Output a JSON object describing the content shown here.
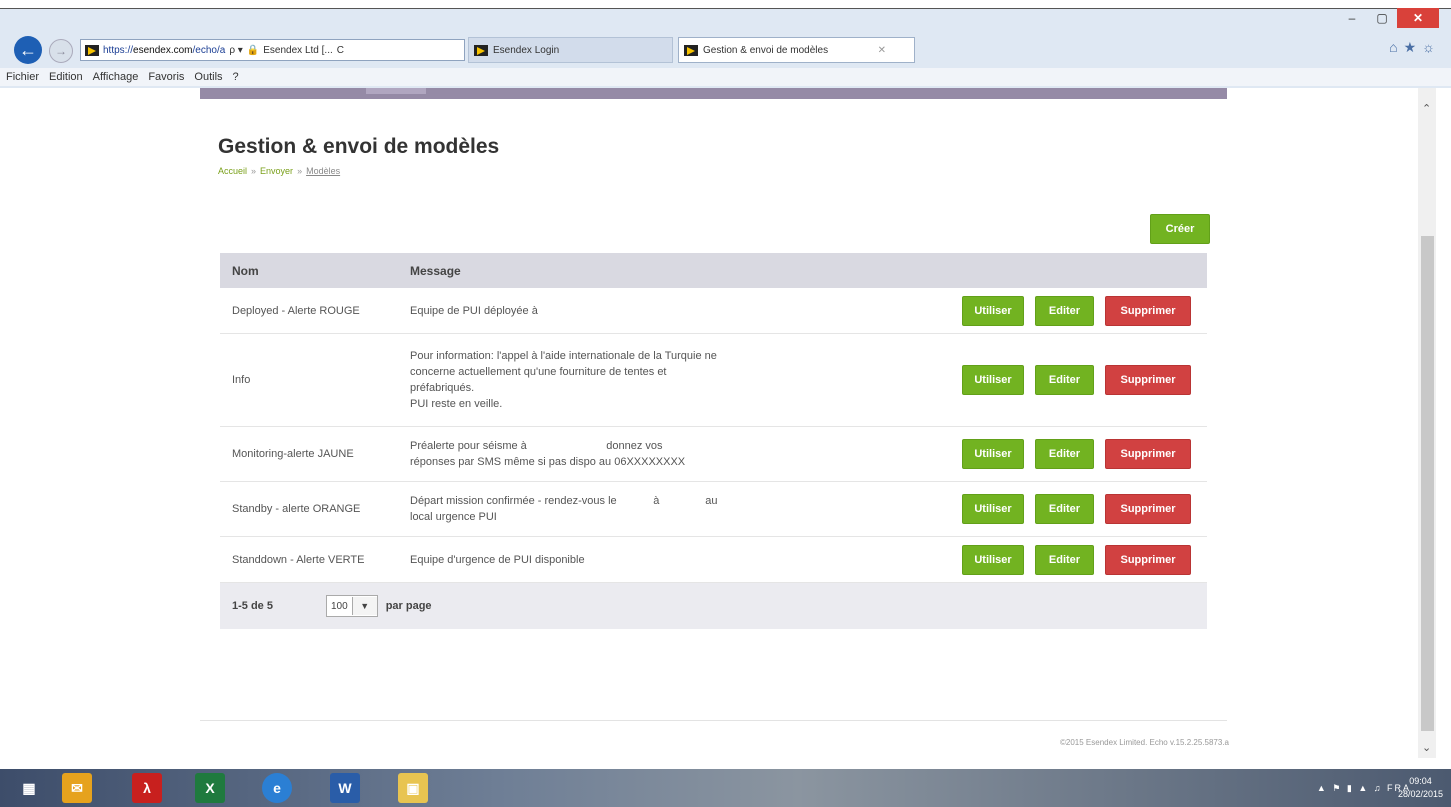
{
  "browser": {
    "address_prefix": "https://",
    "address_domain": "esendex.com",
    "address_path": "/echo/a",
    "search_glyph": "ρ ▾",
    "lock_label": "Esendex Ltd [...",
    "refresh_glyph": "C",
    "tabs": [
      {
        "label": "Esendex Login"
      },
      {
        "label": "Gestion & envoi de modèles",
        "close": "✕"
      }
    ],
    "window_controls": {
      "minimize": "–",
      "restore": "▢",
      "close": "✕"
    },
    "right_icons": "⌂★☼",
    "menu": [
      "Fichier",
      "Edition",
      "Affichage",
      "Favoris",
      "Outils",
      "?"
    ]
  },
  "page": {
    "title": "Gestion & envoi de modèles",
    "breadcrumb": {
      "home": "Accueil",
      "send": "Envoyer",
      "current": "Modèles",
      "separator": "»"
    },
    "create_label": "Créer",
    "columns": {
      "name": "Nom",
      "message": "Message"
    },
    "actions": {
      "use": "Utiliser",
      "edit": "Editer",
      "delete": "Supprimer"
    },
    "rows": [
      {
        "name": "Deployed - Alerte ROUGE",
        "message": [
          "Equipe de PUI déployée à"
        ]
      },
      {
        "name": "Info",
        "message": [
          "Pour information: l'appel à l'aide internationale de la Turquie ne",
          "concerne actuellement qu'une fourniture de tentes et",
          "préfabriqués.",
          "PUI reste en veille."
        ]
      },
      {
        "name": "Monitoring-alerte JAUNE",
        "message": [
          "Préalerte pour séisme à                          donnez vos",
          "réponses par SMS même si pas dispo au 06XXXXXXXX"
        ]
      },
      {
        "name": "Standby - alerte ORANGE",
        "message": [
          "Départ mission confirmée - rendez-vous le            à               au",
          "local urgence PUI"
        ]
      },
      {
        "name": "Standdown - Alerte VERTE",
        "message": [
          "Equipe d'urgence de PUI disponible"
        ]
      }
    ],
    "pagination": {
      "range": "1-5 de 5",
      "per_page_value": "100",
      "per_page_label": "par page"
    },
    "copyright": "©2015 Esendex Limited. Echo v.15.2.25.5873.a"
  },
  "taskbar": {
    "apps": [
      "windows-start",
      "outlook",
      "acrobat",
      "excel",
      "internet-explorer",
      "word",
      "file-explorer"
    ],
    "language": "FRA",
    "time": "09:04",
    "date": "28/02/2015"
  },
  "colors": {
    "green": "#72b321",
    "red": "#d14141",
    "purple_bar": "#958aa6",
    "header_bg": "#d9d9e1"
  }
}
